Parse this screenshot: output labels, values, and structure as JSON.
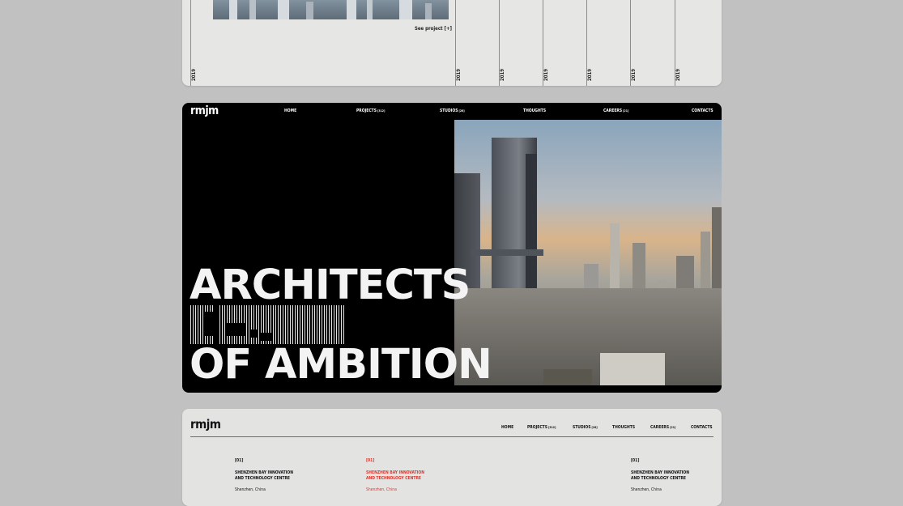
{
  "card1": {
    "years": [
      "2019",
      "2019",
      "2019",
      "2019",
      "2019",
      "2019",
      "2019"
    ],
    "see_project": "See project [+]"
  },
  "brand": {
    "logo": "rmjm"
  },
  "nav": {
    "home": "HOME",
    "projects": "PROJECTS",
    "projects_count": "[312]",
    "studios": "STUDIOS",
    "studios_count": "[28]",
    "thoughts": "THOUGHTS",
    "careers": "CAREERS",
    "careers_count": "[21]",
    "contacts": "CONTACTS"
  },
  "hero": {
    "line1": "ARCHITECTS",
    "line2": "OF AMBITION"
  },
  "projects": [
    {
      "number": "[01]",
      "title1": "SHENZHEN BAY INNOVATION",
      "title2": "AND TECHNOLOGY CENTRE",
      "location": "Shenzhen, China",
      "highlighted": false
    },
    {
      "number": "[01]",
      "title1": "SHENZHEN BAY INNOVATION",
      "title2": "AND TECHNOLOGY CENTRE",
      "location": "Shenzhen, China",
      "highlighted": true
    },
    {
      "number": "[01]",
      "title1": "SHENZHEN BAY INNOVATION",
      "title2": "AND TECHNOLOGY CENTRE",
      "location": "Shenzhen, China",
      "highlighted": false
    }
  ],
  "colors": {
    "accent": "#e0352b",
    "hero_bg": "#000000",
    "card_bg": "#e6e6e4",
    "page_bg": "#c1c1c1"
  }
}
